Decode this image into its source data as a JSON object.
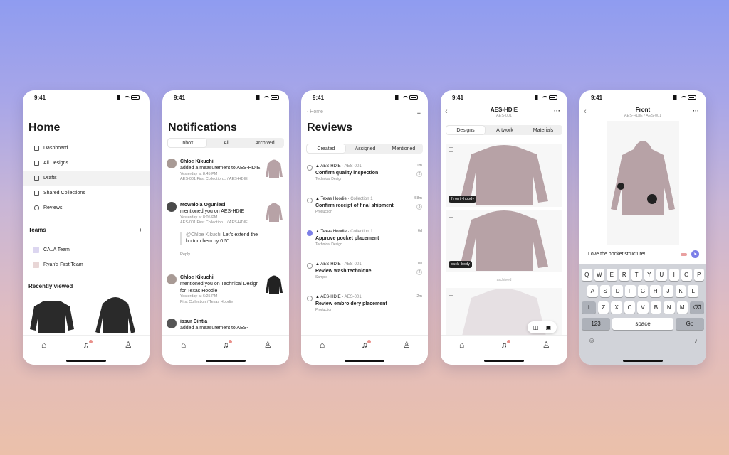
{
  "status_time": "9:41",
  "home": {
    "title": "Home",
    "nav": [
      "Dashboard",
      "All Designs",
      "Drafts",
      "Shared Collections",
      "Reviews"
    ],
    "teams_heading": "Teams",
    "add": "+",
    "teams": [
      "CALA Team",
      "Ryan's First Team"
    ],
    "recent_heading": "Recently viewed"
  },
  "notifications": {
    "title": "Notifications",
    "tabs": [
      "Inbox",
      "All",
      "Archived"
    ],
    "items": [
      {
        "name": "Chloe Kikuchi",
        "text": "added a measurement to AES-HDIE",
        "time": "Yesterday at 8:45 PM",
        "path": "AES-001 First Collection... / AES-HDIE"
      },
      {
        "name": "Mowalola Ogunlesi",
        "text": "mentioned you on AES-HDIE",
        "time": "Yesterday at 8:05 PM",
        "path": "AES-001 First Collection... / AES-HDIE",
        "mention": "@Chloe Kikuchi",
        "comment": "Let's extend the bottom hem by 0.5\"",
        "reply": "Reply"
      },
      {
        "name": "Chloe Kikuchi",
        "text": "mentioned you on Technical Design for Texas Hoodie",
        "time": "Yesterday at 6:25 PM",
        "path": "First Collection / Texas Hoodie"
      },
      {
        "name": "issur Cintia",
        "text": "added a measurement to AES-"
      }
    ]
  },
  "reviews": {
    "back": "Home",
    "title": "Reviews",
    "tabs": [
      "Created",
      "Assigned",
      "Mentioned"
    ],
    "items": [
      {
        "design": "AES-HDIE",
        "coll": "AES-001",
        "title": "Confirm quality inspection",
        "tag": "Technical Design",
        "time": "11m",
        "count": "2"
      },
      {
        "design": "Texas Hoodie",
        "coll": "Collection 1",
        "title": "Confirm receipt of final shipment",
        "tag": "Production",
        "time": "58m",
        "count": "3"
      },
      {
        "design": "Texas Hoodie",
        "coll": "Collection 1",
        "title": "Approve pocket placement",
        "tag": "Technical Design",
        "time": "6d",
        "count": ""
      },
      {
        "design": "AES-HDIE",
        "coll": "AES-001",
        "title": "Review wash technique",
        "tag": "Sample",
        "time": "1w",
        "count": "2"
      },
      {
        "design": "AES-HDIE",
        "coll": "AES-001",
        "title": "Review embroidery placement",
        "tag": "Production",
        "time": "2m",
        "count": ""
      }
    ]
  },
  "design": {
    "title": "AES-HDIE",
    "subtitle": "AES-001",
    "tabs": [
      "Designs",
      "Artwork",
      "Materials"
    ],
    "labels": [
      "front-hoody",
      "back-body"
    ],
    "archived": "archived"
  },
  "front": {
    "title": "Front",
    "subtitle": "AES-HDIE / AES-001",
    "comment": "Love the pocket structure!",
    "keys_row1": [
      "Q",
      "W",
      "E",
      "R",
      "T",
      "Y",
      "U",
      "I",
      "O",
      "P"
    ],
    "keys_row2": [
      "A",
      "S",
      "D",
      "F",
      "G",
      "H",
      "J",
      "K",
      "L"
    ],
    "keys_row3": [
      "Z",
      "X",
      "C",
      "V",
      "B",
      "N",
      "M"
    ],
    "key_123": "123",
    "key_space": "space",
    "key_go": "Go"
  }
}
